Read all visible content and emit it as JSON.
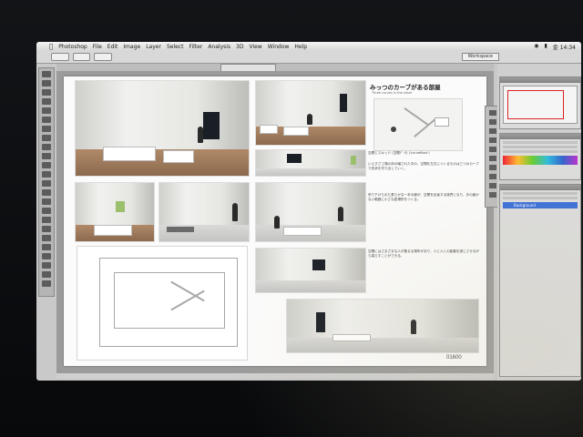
{
  "menubar": {
    "app": "Photoshop",
    "items": [
      "File",
      "Edit",
      "Image",
      "Layer",
      "Select",
      "Filter",
      "Analysis",
      "3D",
      "View",
      "Window",
      "Help"
    ],
    "clock": "金 14:34"
  },
  "document": {
    "heading": "みっつのカーブがある部屋",
    "subheading": "Three curves in the room",
    "caption": "空間とスキッド (空間ﾃﾞｰﾀ) ('curvefloor')",
    "body1": "いえすさ工場の床の曝された中の、空間を左右につくるものは三つのカーブで形状を作り出していく。",
    "body2": "吊り下げられた柔らかな一本の線が、空間を区画する境界となり、手の届かない範囲に小さな居場所をつくる。",
    "body3": "空間にはさまざまな人が集まる場所があり、人と人との距離を感じさせながら暮らすことができる。",
    "board_code": "01600"
  },
  "panels": {
    "layers_label": "Background",
    "workspace": "Workspace"
  },
  "icons": [
    "apple-icon",
    "wifi-icon",
    "battery-icon",
    "tool-icon"
  ]
}
